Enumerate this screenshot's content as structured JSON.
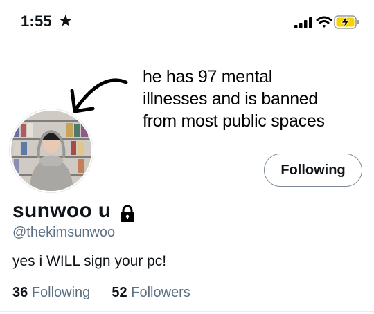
{
  "status_bar": {
    "time": "1:55",
    "star_glyph": "★",
    "icons": [
      "signal-bars-icon",
      "wifi-icon",
      "battery-charging-icon"
    ],
    "battery_color": "#f6d400"
  },
  "annotation": {
    "lines": [
      "he has 97 mental",
      "illnesses and is banned",
      "from most public spaces"
    ]
  },
  "profile": {
    "display_name": "sunwoo u",
    "handle": "@thekimsunwoo",
    "bio": "yes i WILL sign your pc!",
    "follow_button_label": "Following",
    "protected_icon": "lock-icon",
    "following_count": "36",
    "following_label": "Following",
    "followers_count": "52",
    "followers_label": "Followers"
  },
  "colors": {
    "text": "#0f1419",
    "secondary_text": "#5b7083",
    "button_border": "#7c8a97"
  }
}
